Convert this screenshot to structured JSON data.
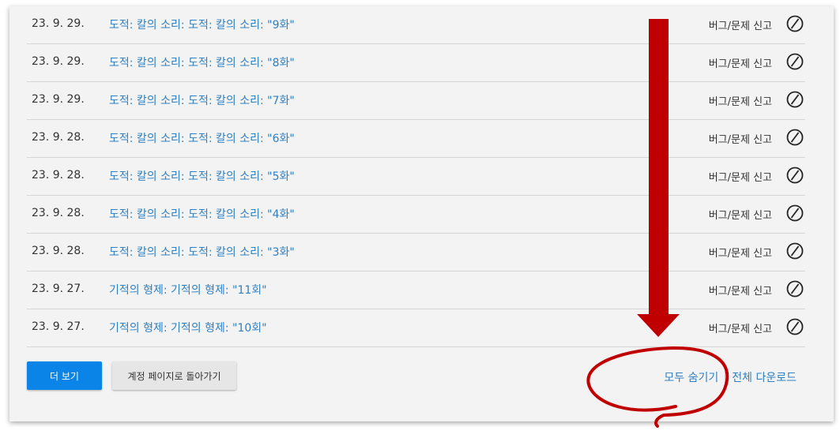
{
  "history": {
    "rows": [
      {
        "date": "23. 9. 29.",
        "title": "도적: 칼의 소리: 도적: 칼의 소리: \"9화\"",
        "report": "버그/문제 신고"
      },
      {
        "date": "23. 9. 29.",
        "title": "도적: 칼의 소리: 도적: 칼의 소리: \"8화\"",
        "report": "버그/문제 신고"
      },
      {
        "date": "23. 9. 29.",
        "title": "도적: 칼의 소리: 도적: 칼의 소리: \"7화\"",
        "report": "버그/문제 신고"
      },
      {
        "date": "23. 9. 28.",
        "title": "도적: 칼의 소리: 도적: 칼의 소리: \"6화\"",
        "report": "버그/문제 신고"
      },
      {
        "date": "23. 9. 28.",
        "title": "도적: 칼의 소리: 도적: 칼의 소리: \"5화\"",
        "report": "버그/문제 신고"
      },
      {
        "date": "23. 9. 28.",
        "title": "도적: 칼의 소리: 도적: 칼의 소리: \"4화\"",
        "report": "버그/문제 신고"
      },
      {
        "date": "23. 9. 28.",
        "title": "도적: 칼의 소리: 도적: 칼의 소리: \"3화\"",
        "report": "버그/문제 신고"
      },
      {
        "date": "23. 9. 27.",
        "title": "기적의 형제: 기적의 형제: \"11회\"",
        "report": "버그/문제 신고"
      },
      {
        "date": "23. 9. 27.",
        "title": "기적의 형제: 기적의 형제: \"10회\"",
        "report": "버그/문제 신고"
      }
    ]
  },
  "buttons": {
    "more": "더 보기",
    "back": "계정 페이지로 돌아가기"
  },
  "links": {
    "hide_all": "모두 숨기기",
    "download_all": "전체 다운로드"
  },
  "icons": {
    "hide": "hide-circle-slash-icon"
  },
  "colors": {
    "link": "#2f7fc1",
    "primary_button": "#0a84e6",
    "annotation": "#c00000"
  }
}
